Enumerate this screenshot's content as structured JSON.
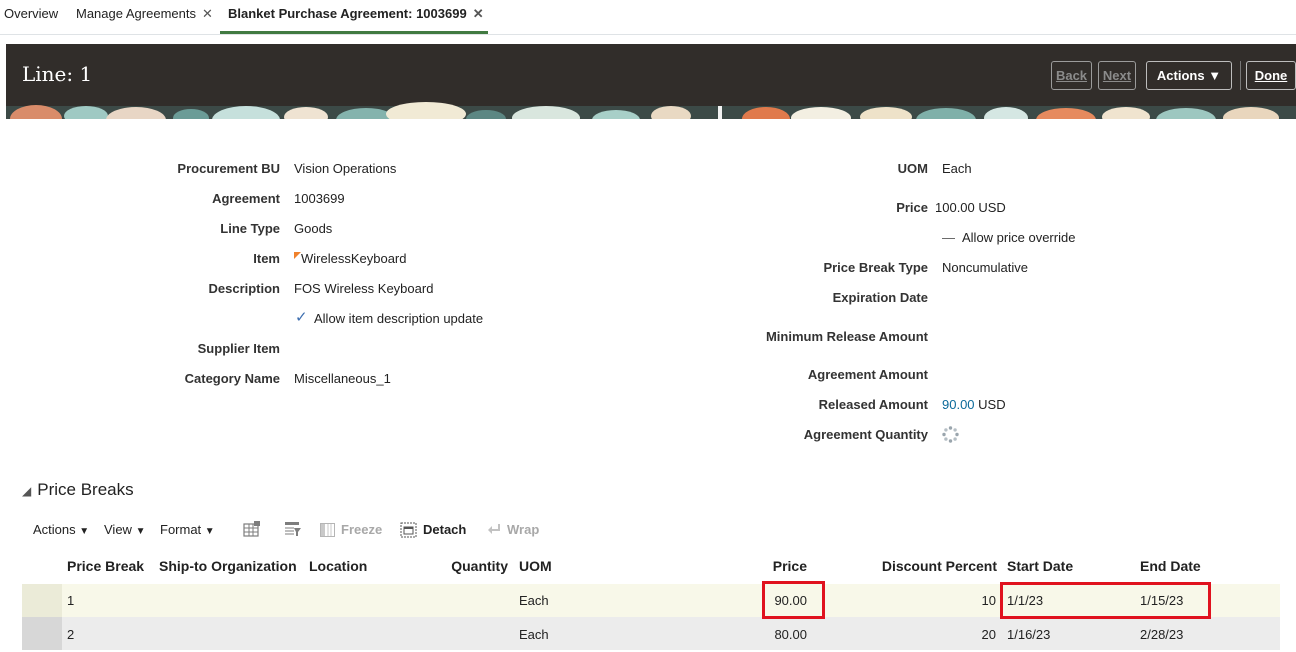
{
  "tabs": [
    {
      "label": "Overview"
    },
    {
      "label": "Manage Agreements"
    },
    {
      "label": "Blanket Purchase Agreement: 1003699"
    }
  ],
  "header": {
    "title": "Line: 1",
    "back_label": "Back",
    "next_label": "Next",
    "actions_label": "Actions",
    "done_label": "Done"
  },
  "left_fields": {
    "procurement_bu": {
      "label": "Procurement BU",
      "value": "Vision Operations"
    },
    "agreement": {
      "label": "Agreement",
      "value": "1003699"
    },
    "line_type": {
      "label": "Line Type",
      "value": "Goods"
    },
    "item": {
      "label": "Item",
      "value": "WirelessKeyboard"
    },
    "description": {
      "label": "Description",
      "value": "FOS Wireless Keyboard"
    },
    "allow_item_description_update": {
      "label": "Allow item description update",
      "checked": true
    },
    "supplier_item": {
      "label": "Supplier Item",
      "value": ""
    },
    "category_name": {
      "label": "Category Name",
      "value": "Miscellaneous_1"
    }
  },
  "right_fields": {
    "uom": {
      "label": "UOM",
      "value": "Each"
    },
    "price": {
      "label": "Price",
      "value": "100.00 USD"
    },
    "allow_price_override": {
      "label": "Allow price override",
      "checked": false
    },
    "price_break_type": {
      "label": "Price Break Type",
      "value": "Noncumulative"
    },
    "expiration_date": {
      "label": "Expiration Date",
      "value": ""
    },
    "minimum_release_amount": {
      "label": "Minimum Release Amount",
      "value": ""
    },
    "agreement_amount": {
      "label": "Agreement Amount",
      "value": ""
    },
    "released_amount": {
      "label": "Released Amount",
      "amount": "90.00",
      "currency": "USD"
    },
    "agreement_quantity": {
      "label": "Agreement Quantity",
      "value": ""
    }
  },
  "price_breaks": {
    "title": "Price Breaks",
    "toolbar": {
      "actions": "Actions",
      "view": "View",
      "format": "Format",
      "freeze": "Freeze",
      "detach": "Detach",
      "wrap": "Wrap"
    },
    "columns": [
      "Price Break",
      "Ship-to Organization",
      "Location",
      "Quantity",
      "UOM",
      "Price",
      "Discount Percent",
      "Start Date",
      "End Date"
    ],
    "rows": [
      {
        "price_break": "1",
        "ship_to": "",
        "location": "",
        "quantity": "",
        "uom": "Each",
        "price": "90.00",
        "discount": "10",
        "start_date": "1/1/23",
        "end_date": "1/15/23"
      },
      {
        "price_break": "2",
        "ship_to": "",
        "location": "",
        "quantity": "",
        "uom": "Each",
        "price": "80.00",
        "discount": "20",
        "start_date": "1/16/23",
        "end_date": "2/28/23"
      }
    ]
  },
  "colors": {
    "banner_bg": "#312d2a",
    "active_tab_underline": "#417a41",
    "link": "#0b6a9a",
    "highlight_box": "#e0121e",
    "selected_row": "#f8f8e9"
  },
  "icons": [
    "close-icon",
    "dropdown-caret-icon",
    "checkmark-icon",
    "loading-spinner-icon",
    "collapse-triangle-icon",
    "query-by-example-icon",
    "filter-icon",
    "freeze-icon",
    "detach-icon",
    "wrap-icon",
    "new-item-flag-icon"
  ]
}
